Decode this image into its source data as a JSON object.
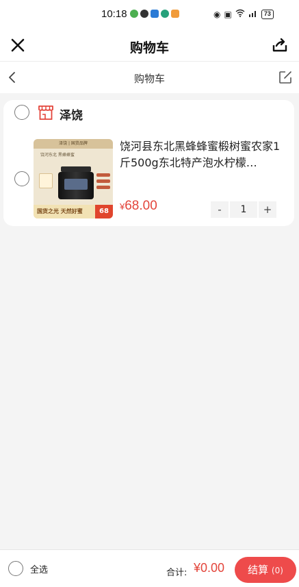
{
  "status_bar": {
    "time": "10:18",
    "battery": "73",
    "icons": [
      "eye-icon",
      "nfc-icon",
      "wifi-icon",
      "5g-signal-icon",
      "battery-icon"
    ]
  },
  "nav": {
    "title": "购物车",
    "close_icon": "close-icon",
    "share_icon": "share-icon"
  },
  "sub_nav": {
    "title": "购物车",
    "back_icon": "chevron-left-icon",
    "edit_icon": "edit-icon"
  },
  "store": {
    "name": "泽饶",
    "icon": "store-icon",
    "items": [
      {
        "title": "饶河县东北黑蜂蜂蜜椴树蜜农家1斤500g东北特产泡水柠檬…",
        "price_symbol": "¥",
        "price": "68.00",
        "quantity": "1",
        "thumb": {
          "top_text": "泽饶 | 国货品牌",
          "sub_text": "饶河东北 黑蜂蜂蜜",
          "bottom_text": "国货之光 天然好蜜",
          "price_tag": "68"
        }
      }
    ]
  },
  "stepper": {
    "minus": "-",
    "plus": "+"
  },
  "bottom_bar": {
    "select_all": "全选",
    "total_label": "合计:",
    "total_value": "¥0.00",
    "checkout_label": "结算",
    "checkout_count": "(0)"
  },
  "colors": {
    "accent": "#ee4b4b",
    "price": "#e3443a",
    "background": "#f4f4f4"
  }
}
